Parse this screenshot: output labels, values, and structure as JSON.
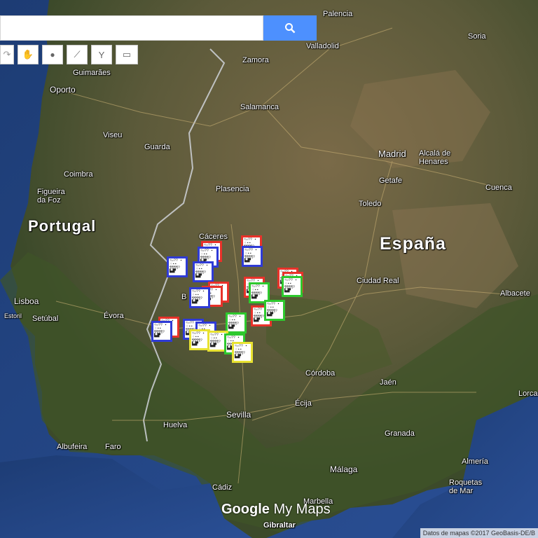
{
  "toolbar": {
    "tools": [
      {
        "name": "redo-icon",
        "glyph": "↷"
      },
      {
        "name": "hand-icon",
        "glyph": "✋"
      },
      {
        "name": "marker-icon",
        "glyph": "●"
      },
      {
        "name": "draw-line-icon",
        "glyph": "⟋"
      },
      {
        "name": "directions-icon",
        "glyph": "Y"
      },
      {
        "name": "ruler-icon",
        "glyph": "▭"
      }
    ]
  },
  "search": {
    "placeholder": "",
    "button_icon": "search-icon"
  },
  "labels": {
    "palencia": "Palencia",
    "soria": "Soria",
    "guimaraes": "Guimarães",
    "valladolid": "Valladolid",
    "zamora": "Zamora",
    "oporto": "Oporto",
    "salamanca": "Salamanca",
    "viseu": "Viseu",
    "guarda": "Guarda",
    "madrid": "Madrid",
    "alcala": "Alcalá de\nHenares",
    "coimbra": "Coimbra",
    "getafe": "Getafe",
    "figueira": "Figueira\nda Foz",
    "plasencia": "Plasencia",
    "cuenca": "Cuenca",
    "toledo": "Toledo",
    "portugal": "Portugal",
    "caceres": "Cáceres",
    "espana": "España",
    "ciudad_real": "Ciudad Real",
    "albacete": "Albacete",
    "lisboa": "Lisboa",
    "estoril": "Estoril",
    "setubal": "Setúbal",
    "evora": "Évora",
    "cordoba": "Córdoba",
    "jaen": "Jaén",
    "lorca": "Lorca",
    "sevilla": "Sevilla",
    "ecija": "Écija",
    "huelva": "Huelva",
    "granada": "Granada",
    "albufeira": "Albufeira",
    "faro": "Faro",
    "almeria": "Almería",
    "malaga": "Málaga",
    "cadiz": "Cádiz",
    "marbella": "Marbella",
    "roquetas": "Roquetas\nde Mar",
    "gibraltar": "Gibraltar",
    "b_label": "B"
  },
  "logo": {
    "google": "Google",
    "mymaps": " My Maps"
  },
  "attribution": "Datos de mapas ©2017 GeoBasis-DE/B",
  "marker_text": "≈☼?? ▪\n⁘▪▪\n¶¶¶¶?\n▙▟▛",
  "colors": {
    "red": "#e8322a",
    "blue": "#2f3bd6",
    "green": "#2ec92e",
    "yellow": "#e8e232",
    "search_button": "#4d90fe"
  }
}
